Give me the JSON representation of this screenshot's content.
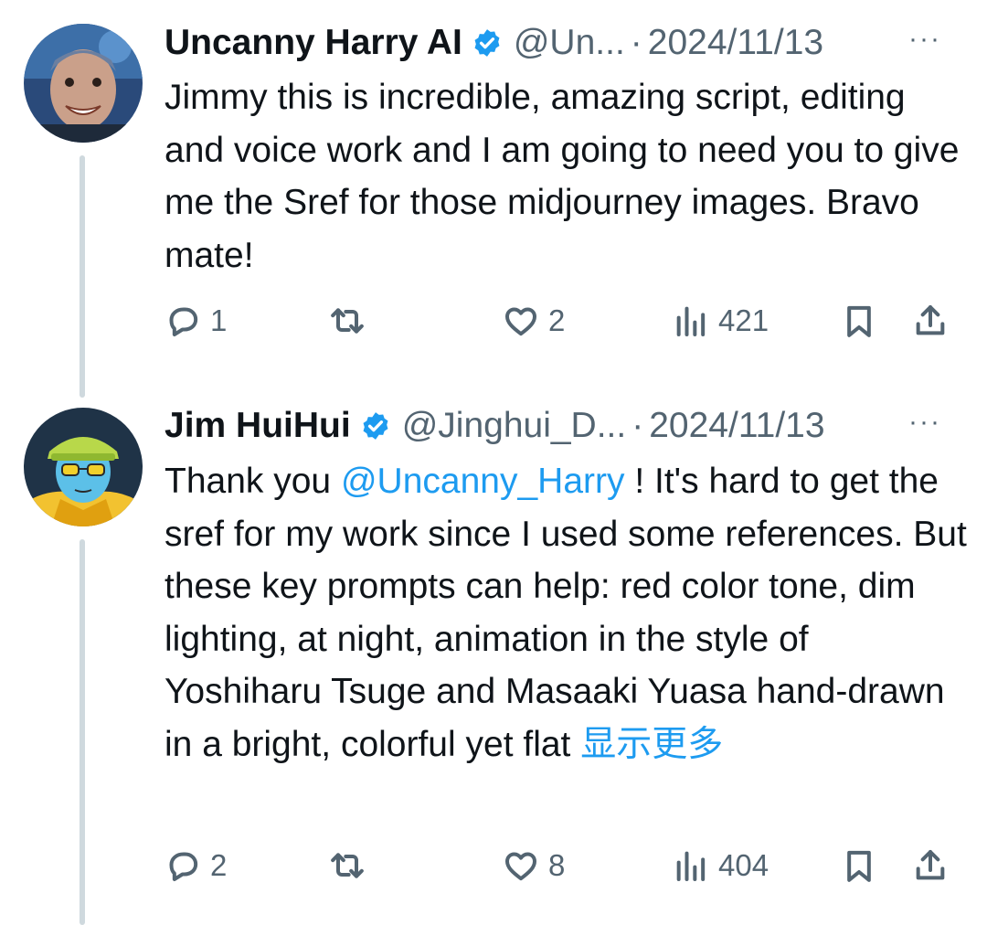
{
  "tweets": [
    {
      "name": "Uncanny Harry AI",
      "handle": "@Un...",
      "sep": "·",
      "date": "2024/11/13",
      "more": "···",
      "text": "Jimmy this is incredible, amazing script, editing and voice work and I am going to need you to give me the Sref for those midjourney images. Bravo mate!",
      "replies": "1",
      "retweets": "",
      "likes": "2",
      "views": "421"
    },
    {
      "name": "Jim HuiHui",
      "handle": "@Jinghui_D...",
      "sep": "·",
      "date": "2024/11/13",
      "more": "···",
      "text_before": "Thank you ",
      "mention": "@Uncanny_Harry",
      "text_after": " ! It's hard to get the sref for my work since I used some references. But these key prompts can help: red color tone, dim lighting, at night, animation in the style of Yoshiharu Tsuge and Masaaki Yuasa hand-drawn in a bright, colorful yet flat ",
      "show_more": "显示更多",
      "replies": "2",
      "retweets": "",
      "likes": "8",
      "views": "404"
    }
  ],
  "icons": {
    "verified": "verified-badge-icon",
    "reply": "reply-icon",
    "retweet": "retweet-icon",
    "like": "heart-icon",
    "views": "views-bar-chart-icon",
    "bookmark": "bookmark-icon",
    "share": "share-icon"
  },
  "colors": {
    "accent": "#1d9bf0",
    "text": "#0f1419",
    "secondary": "#536471",
    "thread_line": "#cfd9de"
  }
}
